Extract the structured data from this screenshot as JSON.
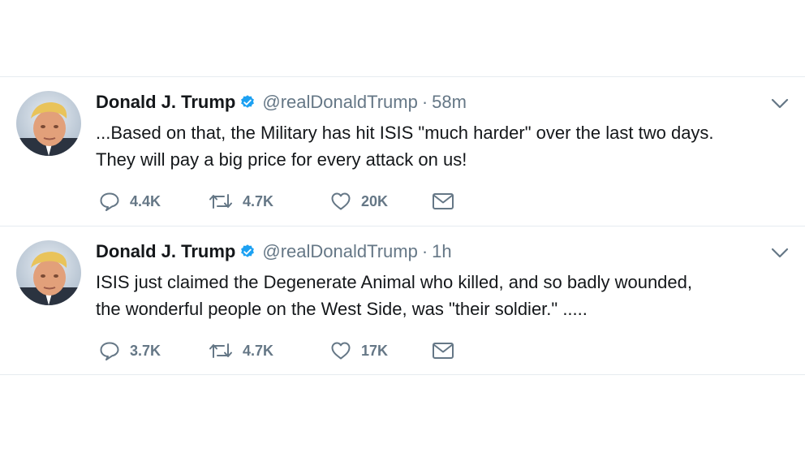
{
  "tweets": [
    {
      "name": "Donald J. Trump",
      "handle": "@realDonaldTrump",
      "time": "58m",
      "separator": "·",
      "text_line1": "...Based on that, the Military has hit ISIS \"much harder\" over the last two days.",
      "text_line2": "They will pay a big price for every attack on us!",
      "replies": "4.4K",
      "retweets": "4.7K",
      "likes": "20K"
    },
    {
      "name": "Donald J. Trump",
      "handle": "@realDonaldTrump",
      "time": "1h",
      "separator": "·",
      "text_line1": "ISIS just claimed the Degenerate Animal who killed, and so badly wounded,",
      "text_line2": "the wonderful people on the West Side, was \"their soldier.\" .....",
      "replies": "3.7K",
      "retweets": "4.7K",
      "likes": "17K"
    }
  ],
  "colors": {
    "verified": "#1da1f2",
    "meta": "#657786",
    "text": "#14171a",
    "divider": "#e6ecf0"
  }
}
